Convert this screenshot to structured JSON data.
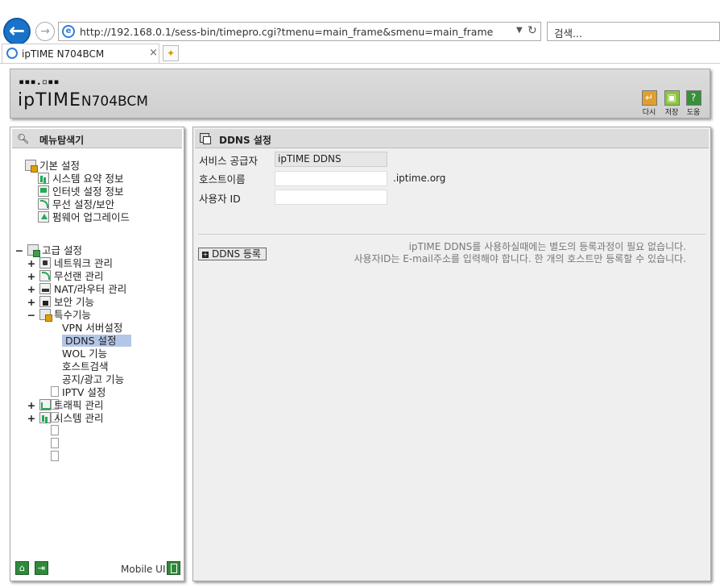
{
  "browser": {
    "url": "http://192.168.0.1/sess-bin/timepro.cgi?tmenu=main_frame&smenu=main_frame",
    "search_placeholder": "검색...",
    "tab_title": "ipTIME N704BCM"
  },
  "header": {
    "logo_brand": "ipTIME",
    "logo_model": "N704BCM",
    "buttons": [
      {
        "label": "다시",
        "color": "#e0a030"
      },
      {
        "label": "저장",
        "color": "#8cc63f"
      },
      {
        "label": "도움",
        "color": "#3a8f3a"
      }
    ]
  },
  "menu": {
    "title": "메뉴탐색기",
    "basic": {
      "label": "기본 설정",
      "items": [
        "시스템 요약 정보",
        "인터넷 설정 정보",
        "무선 설정/보안",
        "펌웨어 업그레이드"
      ]
    },
    "advanced": {
      "toggle": "−",
      "label": "고급 설정",
      "items": [
        {
          "toggle": "+",
          "label": "네트워크 관리"
        },
        {
          "toggle": "+",
          "label": "무선랜 관리"
        },
        {
          "toggle": "+",
          "label": "NAT/라우터 관리"
        },
        {
          "toggle": "+",
          "label": "보안 기능"
        },
        {
          "toggle": "−",
          "label": "특수기능"
        }
      ],
      "special_items": [
        "VPN 서버설정",
        "DDNS 설정",
        "WOL 기능",
        "호스트검색",
        "공지/광고 기능",
        "IPTV 설정"
      ],
      "tail_items": [
        {
          "toggle": "+",
          "label": "트래픽 관리"
        },
        {
          "toggle": "+",
          "label": "시스템 관리"
        }
      ]
    },
    "mobile_label": "Mobile UI"
  },
  "content": {
    "title": "DDNS 설정",
    "service_label": "서비스 공급자",
    "service_value": "ipTIME DDNS",
    "host_label": "호스트이름",
    "host_value": "",
    "host_suffix": ".iptime.org",
    "user_label": "사용자 ID",
    "user_value": "",
    "register_button": "DDNS 등록",
    "notice_line1": "ipTIME DDNS를 사용하실때에는 별도의 등록과정이 필요 없습니다.",
    "notice_line2": "사용자ID는 E-mail주소를 입력해야 합니다. 한 개의 호스트만 등록할 수 있습니다."
  }
}
